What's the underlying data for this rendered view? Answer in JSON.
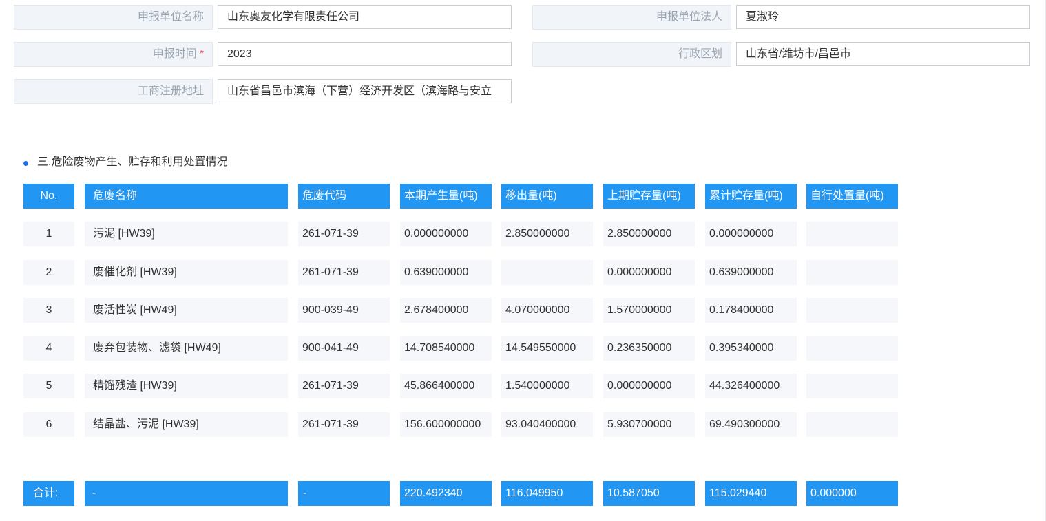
{
  "form": {
    "unit_name_label": "申报单位名称",
    "unit_name_value": "山东奥友化学有限责任公司",
    "legal_person_label": "申报单位法人",
    "legal_person_value": "夏淑玲",
    "report_time_label": "申报时间",
    "report_time_required": "*",
    "report_time_value": "2023",
    "region_label": "行政区划",
    "region_value": "山东省/潍坊市/昌邑市",
    "address_label": "工商注册地址",
    "address_value": "山东省昌邑市滨海（下营）经济开发区（滨海路与安立"
  },
  "section": {
    "title": "三.危险废物产生、贮存和利用处置情况"
  },
  "table": {
    "headers": [
      "No.",
      "危废名称",
      "危废代码",
      "本期产生量(吨)",
      "移出量(吨)",
      "上期贮存量(吨)",
      "累计贮存量(吨)",
      "自行处置量(吨)"
    ],
    "rows": [
      [
        "1",
        "污泥 [HW39]",
        "261-071-39",
        "0.000000000",
        "2.850000000",
        "2.850000000",
        "0.000000000",
        ""
      ],
      [
        "2",
        "废催化剂 [HW39]",
        "261-071-39",
        "0.639000000",
        "",
        "0.000000000",
        "0.639000000",
        ""
      ],
      [
        "3",
        "废活性炭 [HW49]",
        "900-039-49",
        "2.678400000",
        "4.070000000",
        "1.570000000",
        "0.178400000",
        ""
      ],
      [
        "4",
        "废弃包装物、滤袋 [HW49]",
        "900-041-49",
        "14.708540000",
        "14.549550000",
        "0.236350000",
        "0.395340000",
        ""
      ],
      [
        "5",
        "精馏残渣 [HW39]",
        "261-071-39",
        "45.866400000",
        "1.540000000",
        "0.000000000",
        "44.326400000",
        ""
      ],
      [
        "6",
        "结晶盐、污泥 [HW39]",
        "261-071-39",
        "156.600000000",
        "93.040400000",
        "5.930700000",
        "69.490300000",
        ""
      ]
    ],
    "totals": [
      "合计:",
      "-",
      "-",
      "220.492340",
      "116.049950",
      "10.587050",
      "115.029440",
      "0.000000"
    ]
  },
  "colors": {
    "header_bg": "#2196f3",
    "accent_bullet": "#1a73e8",
    "required_mark": "#ea5a5a",
    "label_bg": "#f1f5fa",
    "cell_bg": "#f5f7fa"
  }
}
